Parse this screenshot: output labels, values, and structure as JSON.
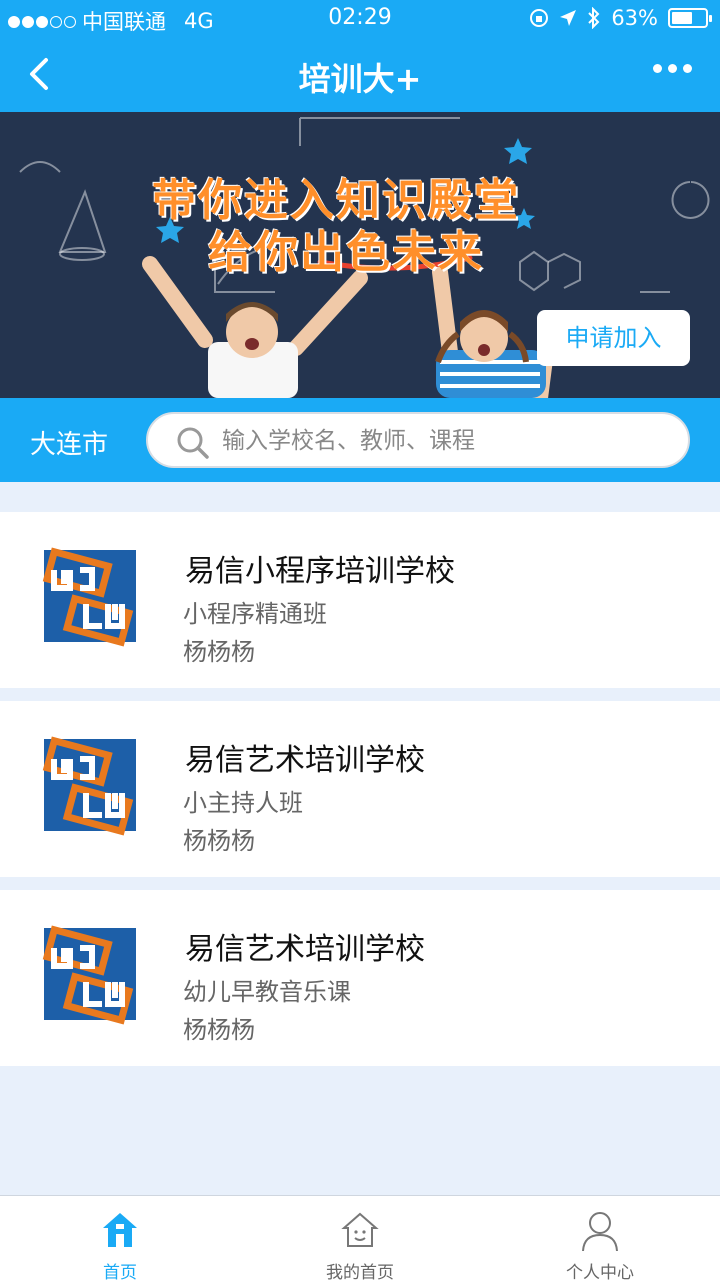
{
  "status_bar": {
    "carrier": "中国联通",
    "network": "4G",
    "time": "02:29",
    "battery": "63%",
    "battery_level": 0.63
  },
  "nav": {
    "title": "培训大+"
  },
  "banner": {
    "headline_line1": "带你进入知识殿堂",
    "headline_line2": "给你出色未来",
    "apply_label": "申请加入"
  },
  "search": {
    "city": "大连市",
    "placeholder": "输入学校名、教师、课程"
  },
  "schools": [
    {
      "name": "易信小程序培训学校",
      "course": "小程序精通班",
      "teacher": "杨杨杨"
    },
    {
      "name": "易信艺术培训学校",
      "course": "小主持人班",
      "teacher": "杨杨杨"
    },
    {
      "name": "易信艺术培训学校",
      "course": "幼儿早教音乐课",
      "teacher": "杨杨杨"
    }
  ],
  "tabs": [
    {
      "label": "首页",
      "icon": "home-icon",
      "active": true
    },
    {
      "label": "我的首页",
      "icon": "my-home-icon",
      "active": false
    },
    {
      "label": "个人中心",
      "icon": "person-icon",
      "active": false
    }
  ],
  "colors": {
    "primary": "#1aaaf5",
    "logo_blue": "#1d5fa8",
    "logo_orange": "#e8791e"
  }
}
